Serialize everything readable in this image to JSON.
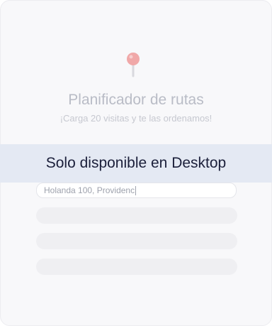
{
  "header": {
    "icon": "map-pin-icon",
    "title": "Planificador de rutas",
    "subtitle": "¡Carga 20 visitas y te las ordenamos!"
  },
  "banner": {
    "text": "Solo disponible en Desktop"
  },
  "address_input": {
    "value": "Holanda 100, Providenc"
  },
  "colors": {
    "pin": "#f0a8a8",
    "banner_bg": "#e4e9f3",
    "banner_text": "#1b1f3a",
    "muted_text": "#b9bcc6"
  }
}
